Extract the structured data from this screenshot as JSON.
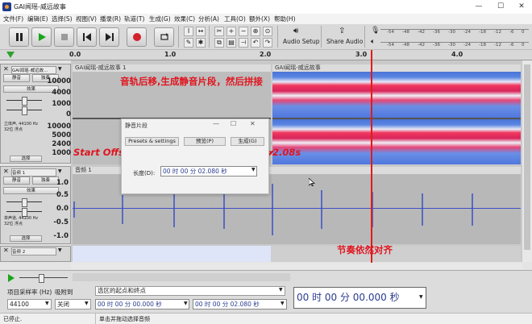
{
  "window": {
    "title": "GAI闻瑶-威远故事",
    "minimize": "—",
    "maximize": "☐",
    "close": "✕"
  },
  "menu": [
    "文件(F)",
    "编辑(E)",
    "选择(S)",
    "视图(V)",
    "播录(R)",
    "轨道(T)",
    "生成(G)",
    "效果(C)",
    "分析(A)",
    "工具(O)",
    "额外(X)",
    "帮助(H)"
  ],
  "toolbar": {
    "audio_setup": "Audio Setup",
    "share_audio": "Share Audio",
    "meter_ticks": [
      "-54",
      "-48",
      "-42",
      "-36",
      "-30",
      "-24",
      "-18",
      "-12",
      "-6",
      "0"
    ]
  },
  "ruler": {
    "ticks": [
      "0.0",
      "1.0",
      "2.0",
      "3.0",
      "4.0"
    ]
  },
  "tracks": {
    "track1": {
      "name": "GAI闻瑶-威远故...",
      "mute": "静音",
      "solo": "独奏",
      "effects": "效果",
      "info": "立体声, 44100 Hz\n32位 浮点",
      "select": "选择",
      "clip_left": "GAI闻瑶-威远故事 1",
      "clip_right": "GAI闻瑶-威远故事",
      "scale_top": [
        "10000",
        "4000",
        "1000",
        "0"
      ],
      "scale_bottom": [
        "10000",
        "5000",
        "2400",
        "1000"
      ]
    },
    "track2": {
      "name": "音频 1",
      "mute": "静音",
      "solo": "独奏",
      "effects": "效果",
      "info": "单声道, 44100 Hz\n32位 浮点",
      "select": "选择",
      "clip": "音频 1",
      "scale": [
        "1.0",
        "0.5",
        "0.0",
        "-0.5",
        "-1.0"
      ]
    },
    "track3": {
      "name": "音频 2"
    }
  },
  "dialog": {
    "title": "静音片段",
    "presets": "Presets & settings",
    "preview": "预览(P)",
    "generate": "生成(G)",
    "duration_label": "长度(D):",
    "duration_value": "00 时 00 分 02.080 秒"
  },
  "annotations": {
    "top": "音轨后移,生成静音片段，然后拼接",
    "middle": "Start Offset: = 60/BPM*n = 60/115*4=2.08s",
    "bottom": "节奏依然对齐"
  },
  "bottom": {
    "rate_label": "项目采样率 (Hz)",
    "snap_label": "吸附到",
    "rate_value": "44100",
    "snap_value": "关闭",
    "sel_label": "选区的起点和终点",
    "sel_start": "00 时 00 分 00.000 秒",
    "sel_end": "00 时 00 分 02.080 秒",
    "big_time": "00 时 00 分 00.000 秒"
  },
  "status": {
    "left": "已停止.",
    "right": "单击并拖动选择音频"
  },
  "colors": {
    "annotation": "#e0151f",
    "playhead": "#e21b1b",
    "waveform": "#3a4fc7"
  }
}
